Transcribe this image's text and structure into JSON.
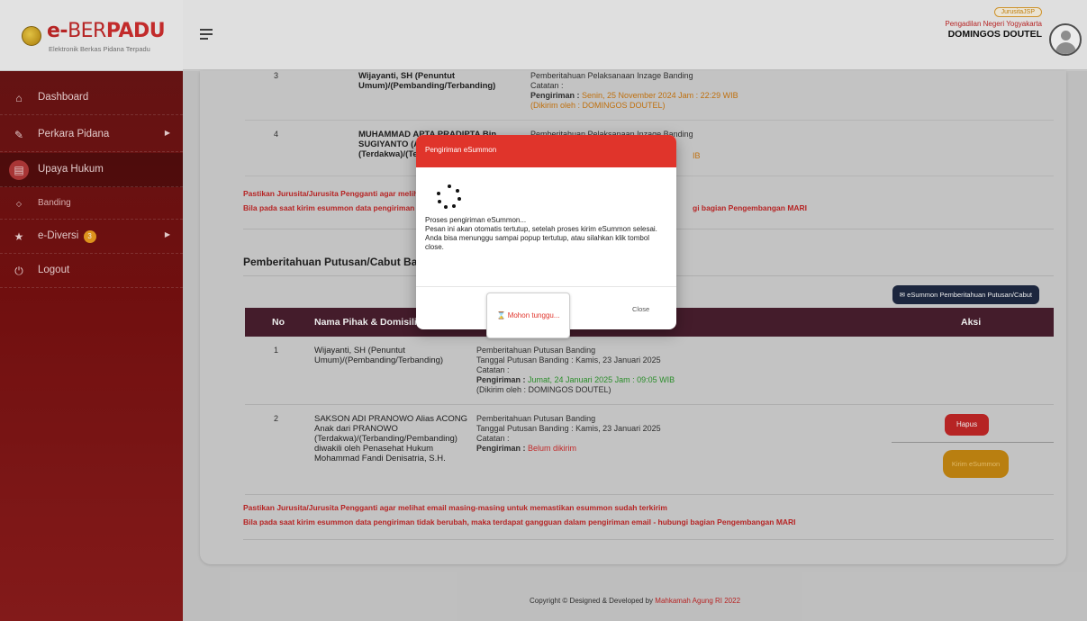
{
  "header": {
    "logo_e": "e-",
    "logo_ber": "BER",
    "logo_padu": "PADU",
    "logo_subtitle": "Elektronik Berkas Pidana Terpadu",
    "role": "JurusitaJSP",
    "court": "Pengadilan Negeri Yogyakarta",
    "user": "DOMINGOS DOUTEL"
  },
  "sidebar": {
    "items": [
      {
        "label": "Dashboard",
        "icon": "home-icon"
      },
      {
        "label": "Perkara Pidana",
        "icon": "edit-icon"
      },
      {
        "label": "Upaya Hukum",
        "icon": "document-icon"
      },
      {
        "label": "Banding",
        "icon": "diamond-icon"
      },
      {
        "label": "e-Diversi",
        "icon": "star-icon",
        "badge": "3"
      },
      {
        "label": "Logout",
        "icon": "power-icon"
      }
    ]
  },
  "upper_table": {
    "rows": [
      {
        "no": "3",
        "name": "Wijayanti, SH (Penuntut Umum)/(Pembanding/Terbanding)",
        "info1": "Pemberitahuan Pelaksanaan Inzage Banding",
        "info2": "Catatan :",
        "send_label": "Pengiriman :",
        "send_value": "Senin, 25 November 2024 Jam : 22:29 WIB",
        "sender": "(Dikirim oleh : DOMINGOS DOUTEL)"
      },
      {
        "no": "4",
        "name": "MUHAMMAD APTA PRADIPTA Bin SUGIYANTO (Alm) (Terdakwa)/(Terbanding/Pem",
        "info1": "Pemberitahuan Pelaksanaan Inzage Banding",
        "tail": "IB"
      }
    ],
    "warn1_left": "Pastikan Jurusita/Jurusita Pengganti agar melihat e",
    "warn2_left": "Bila pada saat kirim esummon data pengiriman tidak",
    "warn2_right": "gi bagian Pengembangan MARI"
  },
  "section": {
    "title": "Pemberitahuan Putusan/Cabut Banding",
    "esummon_button": "eSummon Pemberitahuan Putusan/Cabut"
  },
  "lower_table": {
    "headers": {
      "no": "No",
      "name": "Nama Pihak & Domisili Ele",
      "aksi": "Aksi"
    },
    "rows": [
      {
        "no": "1",
        "name": "Wijayanti, SH (Penuntut Umum)/(Pembanding/Terbanding)",
        "info1": "Pemberitahuan Putusan Banding",
        "info2": "Tanggal Putusan Banding : Kamis, 23 Januari 2025",
        "info3": "Catatan :",
        "send_label": "Pengiriman :",
        "send_value": "Jumat, 24 Januari 2025 Jam : 09:05 WIB",
        "sender": "(Dikirim oleh : DOMINGOS DOUTEL)"
      },
      {
        "no": "2",
        "name": "SAKSON ADI PRANOWO Alias ACONG Anak dari PRANOWO (Terdakwa)/(Terbanding/Pembanding) diwakili oleh Penasehat Hukum Mohammad Fandi Denisatria, S.H.",
        "info1": "Pemberitahuan Putusan Banding",
        "info2": "Tanggal Putusan Banding : Kamis, 23 Januari 2025",
        "info3": "Catatan :",
        "send_label": "Pengiriman :",
        "send_value": "Belum dikirim",
        "hapus": "Hapus",
        "kirim": "Kirim eSummon"
      }
    ],
    "warn1": "Pastikan Jurusita/Jurusita Pengganti agar melihat email masing-masing untuk memastikan esummon sudah terkirim",
    "warn2": "Bila pada saat kirim esummon data pengiriman tidak berubah, maka terdapat gangguan dalam pengiriman email - hubungi bagian Pengembangan MARI"
  },
  "footer": {
    "text": "Copyright © Designed & Developed by",
    "link": "Mahkamah Agung RI 2022"
  },
  "modal": {
    "title": "Pengiriman eSummon",
    "line1": "Proses pengiriman eSummon...",
    "line2": "Pesan ini akan otomatis tertutup, setelah proses kirim eSummon selesai.",
    "line3": "Anda bisa menunggu sampai popup tertutup, atau silahkan klik tombol close.",
    "wait_button": "Mohon tunggu...",
    "close_button": "Close"
  }
}
